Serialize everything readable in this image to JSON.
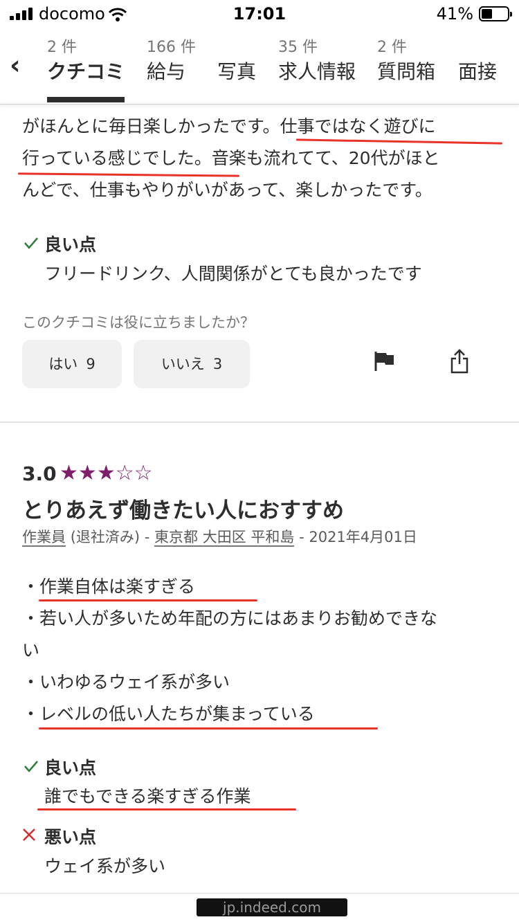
{
  "status_bar": {
    "carrier": "docomo",
    "time": "17:01",
    "battery": "41%"
  },
  "tabs": [
    {
      "count": "2 件",
      "label": "クチコミ",
      "active": true
    },
    {
      "count": "166 件",
      "label": "給与"
    },
    {
      "count": "",
      "label": "写真"
    },
    {
      "count": "35 件",
      "label": "求人情報"
    },
    {
      "count": "2 件",
      "label": "質問箱"
    },
    {
      "count": "",
      "label": "面接"
    }
  ],
  "review1": {
    "lines": [
      "がほんとに毎日楽しかったです。仕事ではなく遊びに",
      "行っている感じでした。音楽も流れてて、20代がほと",
      "んどで、仕事もやりがいがあって、楽しかったです。"
    ],
    "pros_title": "良い点",
    "pros_text": "フリードリンク、人間関係がとても良かったです",
    "helpful_question": "このクチコミは役に立ちましたか？",
    "yes_label": "はい",
    "yes_count": "9",
    "no_label": "いいえ",
    "no_count": "3"
  },
  "review2": {
    "rating": "3.0",
    "stars": 3,
    "star_color": "#7f1f6b",
    "title": "とりあえず働きたい人におすすめ",
    "job": "作業員",
    "status": "(退社済み)",
    "sep1": "-",
    "location": "東京都 大田区 平和島",
    "sep2": "-",
    "date": "2021年4月01日",
    "body_lines": [
      "・作業自体は楽すぎる",
      "・若い人が多いため年配の方にはあまりお勧めできな",
      "い",
      "・いわゆるウェイ系が多い",
      "・レベルの低い人たちが集まっている"
    ],
    "pros_title": "良い点",
    "pros_text": "誰でもできる楽すぎる作業",
    "cons_title": "悪い点",
    "cons_text": "ウェイ系が多い"
  },
  "footer": {
    "url": "jp.indeed.com"
  },
  "colors": {
    "annotation_red": "#e8322a",
    "accent_green": "#2f7d3b"
  }
}
